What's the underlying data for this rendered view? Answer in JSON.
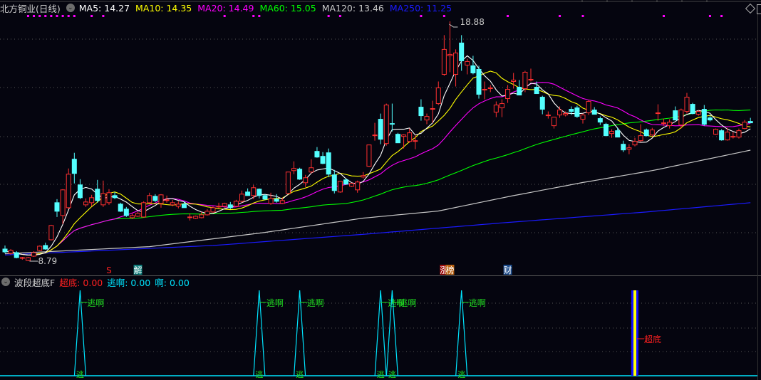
{
  "header": {
    "stock_name": "北方铜业(日线)",
    "toggle_icon": "chevron-down-circle-icon",
    "ma_labels": [
      {
        "text": "MA5: 14.27",
        "color": "#ffffff"
      },
      {
        "text": "MA10: 14.35",
        "color": "#ffff00"
      },
      {
        "text": "MA20: 14.49",
        "color": "#ff00ff"
      },
      {
        "text": "MA60: 15.05",
        "color": "#00ff00"
      },
      {
        "text": "MA120: 13.46",
        "color": "#c8c8c8"
      },
      {
        "text": "MA250: 11.25",
        "color": "#1a1aff"
      }
    ]
  },
  "indicator_header": {
    "name": "波段超底F",
    "labels": [
      {
        "text": "超底: 0.00",
        "color": "#ff2020"
      },
      {
        "text": "逃啊: 0.00",
        "color": "#00e5ff"
      },
      {
        "text": "啊: 0.00",
        "color": "#00e5ff"
      }
    ]
  },
  "chart_data": {
    "type": "candlestick",
    "up_color": "#ff3030",
    "down_color": "#54ffff",
    "ylim": [
      8.79,
      18.88
    ],
    "high_label": "18.88",
    "low_label": "8.79",
    "grid": "dotted",
    "candles_ohlc": [
      [
        9.3,
        9.45,
        9.12,
        9.18
      ],
      [
        9.12,
        9.3,
        9.06,
        9.24
      ],
      [
        9.15,
        9.21,
        8.91,
        8.94
      ],
      [
        8.91,
        8.97,
        8.85,
        8.94
      ],
      [
        8.82,
        8.97,
        8.79,
        8.94
      ],
      [
        9.0,
        9.21,
        8.97,
        9.15
      ],
      [
        9.24,
        9.45,
        9.21,
        9.42
      ],
      [
        9.45,
        9.57,
        9.27,
        9.3
      ],
      [
        9.69,
        10.32,
        9.66,
        10.29
      ],
      [
        11.25,
        11.4,
        10.65,
        10.89
      ],
      [
        10.71,
        11.82,
        10.35,
        11.79
      ],
      [
        11.04,
        12.69,
        10.98,
        12.45
      ],
      [
        13.08,
        13.35,
        12.06,
        12.48
      ],
      [
        12.0,
        12.24,
        11.4,
        11.46
      ],
      [
        11.16,
        11.43,
        11.07,
        11.28
      ],
      [
        11.25,
        11.58,
        11.1,
        11.46
      ],
      [
        11.82,
        12.21,
        11.25,
        11.34
      ],
      [
        11.16,
        12.18,
        11.07,
        11.64
      ],
      [
        11.25,
        11.82,
        11.16,
        11.67
      ],
      [
        11.55,
        11.7,
        11.4,
        11.46
      ],
      [
        11.19,
        11.25,
        10.86,
        10.89
      ],
      [
        10.98,
        11.07,
        10.65,
        10.71
      ],
      [
        10.62,
        10.8,
        10.56,
        10.71
      ],
      [
        10.68,
        10.86,
        10.65,
        10.8
      ],
      [
        10.65,
        11.31,
        10.62,
        11.25
      ],
      [
        11.25,
        11.67,
        11.22,
        11.55
      ],
      [
        11.52,
        11.61,
        11.28,
        11.34
      ],
      [
        11.22,
        11.61,
        11.04,
        11.58
      ],
      [
        11.37,
        11.55,
        11.25,
        11.37
      ],
      [
        11.16,
        11.37,
        11.1,
        11.25
      ],
      [
        11.1,
        11.31,
        11.01,
        11.19
      ],
      [
        11.19,
        11.31,
        11.04,
        11.04
      ],
      [
        10.65,
        10.8,
        10.5,
        10.65
      ],
      [
        10.59,
        10.71,
        10.56,
        10.68
      ],
      [
        10.62,
        10.86,
        10.59,
        10.74
      ],
      [
        10.74,
        10.98,
        10.71,
        10.89
      ],
      [
        10.86,
        11.1,
        10.83,
        11.04
      ],
      [
        11.1,
        11.25,
        11.01,
        11.1
      ],
      [
        11.1,
        11.25,
        11.04,
        11.22
      ],
      [
        11.16,
        11.28,
        10.98,
        11.04
      ],
      [
        11.1,
        11.37,
        11.07,
        11.31
      ],
      [
        11.31,
        11.76,
        11.25,
        11.61
      ],
      [
        11.7,
        11.85,
        11.55,
        11.55
      ],
      [
        11.55,
        12.0,
        11.4,
        11.88
      ],
      [
        11.82,
        11.85,
        11.43,
        11.55
      ],
      [
        11.55,
        11.61,
        11.37,
        11.4
      ],
      [
        11.22,
        11.67,
        11.16,
        11.43
      ],
      [
        11.4,
        11.61,
        11.25,
        11.31
      ],
      [
        11.22,
        11.46,
        11.19,
        11.34
      ],
      [
        11.64,
        12.54,
        11.61,
        12.54
      ],
      [
        12.6,
        12.99,
        12.45,
        12.69
      ],
      [
        12.66,
        12.72,
        12.21,
        12.24
      ],
      [
        12.09,
        12.42,
        11.91,
        12.3
      ],
      [
        12.54,
        13.08,
        12.48,
        12.72
      ],
      [
        13.41,
        13.59,
        13.14,
        13.17
      ],
      [
        13.2,
        13.38,
        12.87,
        12.9
      ],
      [
        13.35,
        13.53,
        12.33,
        12.45
      ],
      [
        12.42,
        12.63,
        11.64,
        11.76
      ],
      [
        11.7,
        12.15,
        11.67,
        12.15
      ],
      [
        12.21,
        12.27,
        12.0,
        12.03
      ],
      [
        11.94,
        12.09,
        11.91,
        12.06
      ],
      [
        11.79,
        12.18,
        11.67,
        12.12
      ],
      [
        12.33,
        12.54,
        12.27,
        12.39
      ],
      [
        12.78,
        13.68,
        12.75,
        13.68
      ],
      [
        14.07,
        14.61,
        13.86,
        14.1
      ],
      [
        14.76,
        15.0,
        13.71,
        13.92
      ],
      [
        13.74,
        15.42,
        13.65,
        15.36
      ],
      [
        14.58,
        15.42,
        14.25,
        14.55
      ],
      [
        14.13,
        14.19,
        13.77,
        13.77
      ],
      [
        14.04,
        14.13,
        13.53,
        14.1
      ],
      [
        13.83,
        14.37,
        13.77,
        14.19
      ],
      [
        13.86,
        14.1,
        13.5,
        13.86
      ],
      [
        15.27,
        15.6,
        14.7,
        14.91
      ],
      [
        14.73,
        15.0,
        14.55,
        14.88
      ],
      [
        15.21,
        15.54,
        14.61,
        15.21
      ],
      [
        15.42,
        16.35,
        15.36,
        16.08
      ],
      [
        16.65,
        18.3,
        16.59,
        17.7
      ],
      [
        17.43,
        18.88,
        16.74,
        17.49
      ],
      [
        16.65,
        17.7,
        16.14,
        17.55
      ],
      [
        17.97,
        18.3,
        16.8,
        17.22
      ],
      [
        17.04,
        17.31,
        16.65,
        17.19
      ],
      [
        17.01,
        17.43,
        16.65,
        16.71
      ],
      [
        16.86,
        17.01,
        15.63,
        15.81
      ],
      [
        15.99,
        16.35,
        15.6,
        16.02
      ],
      [
        16.08,
        16.2,
        15.9,
        16.08
      ],
      [
        15.06,
        15.51,
        14.85,
        15.36
      ],
      [
        15.24,
        15.6,
        14.85,
        15.42
      ],
      [
        15.63,
        16.2,
        15.45,
        16.02
      ],
      [
        16.35,
        16.71,
        16.05,
        16.41
      ],
      [
        16.11,
        16.41,
        15.78,
        15.78
      ],
      [
        16.05,
        16.8,
        15.9,
        16.74
      ],
      [
        16.41,
        16.89,
        16.35,
        16.44
      ],
      [
        16.11,
        16.35,
        15.84,
        15.84
      ],
      [
        15.69,
        15.75,
        14.97,
        15.18
      ],
      [
        14.94,
        15.09,
        14.79,
        14.94
      ],
      [
        14.49,
        14.85,
        14.37,
        14.85
      ],
      [
        14.94,
        15.3,
        14.82,
        15.15
      ],
      [
        14.94,
        15.09,
        14.88,
        15.0
      ],
      [
        15.18,
        15.3,
        14.94,
        15.09
      ],
      [
        15.24,
        15.33,
        14.82,
        14.88
      ],
      [
        14.76,
        15.0,
        14.58,
        14.94
      ],
      [
        15.03,
        15.57,
        14.94,
        15.51
      ],
      [
        15.15,
        15.27,
        14.97,
        14.97
      ],
      [
        14.79,
        14.88,
        14.52,
        14.64
      ],
      [
        14.55,
        14.61,
        14.07,
        14.07
      ],
      [
        14.16,
        14.34,
        13.98,
        14.25
      ],
      [
        14.28,
        14.4,
        14.01,
        14.01
      ],
      [
        13.71,
        13.86,
        13.38,
        13.47
      ],
      [
        13.5,
        13.71,
        13.29,
        13.56
      ],
      [
        13.68,
        13.98,
        13.62,
        13.83
      ],
      [
        13.86,
        14.55,
        13.8,
        14.07
      ],
      [
        14.31,
        14.37,
        14.04,
        14.07
      ],
      [
        14.1,
        14.4,
        14.04,
        14.31
      ],
      [
        15.03,
        15.39,
        14.7,
        15.03
      ],
      [
        14.61,
        14.79,
        14.49,
        14.61
      ],
      [
        14.49,
        14.76,
        14.37,
        14.64
      ],
      [
        15.12,
        15.3,
        14.73,
        14.73
      ],
      [
        14.52,
        15.21,
        14.37,
        15.15
      ],
      [
        15.09,
        15.87,
        15.0,
        15.69
      ],
      [
        15.39,
        15.45,
        14.97,
        15.0
      ],
      [
        14.97,
        15.15,
        14.91,
        15.09
      ],
      [
        15.18,
        15.36,
        14.49,
        14.55
      ],
      [
        14.82,
        14.94,
        14.67,
        14.73
      ],
      [
        14.13,
        14.37,
        14.1,
        14.34
      ],
      [
        14.28,
        14.34,
        13.86,
        13.89
      ],
      [
        13.89,
        14.4,
        13.86,
        14.22
      ],
      [
        14.04,
        14.22,
        13.95,
        14.04
      ],
      [
        14.01,
        14.37,
        13.95,
        14.28
      ],
      [
        14.37,
        14.73,
        14.34,
        14.64
      ],
      [
        14.67,
        14.82,
        14.61,
        14.61
      ]
    ],
    "ma_lines": [
      {
        "name": "MA5",
        "period": 5,
        "color": "#ffffff"
      },
      {
        "name": "MA10",
        "period": 10,
        "color": "#ffff00"
      },
      {
        "name": "MA20",
        "period": 20,
        "color": "#ff00ff"
      },
      {
        "name": "MA60",
        "period": 60,
        "color": "#00ff00"
      }
    ],
    "ma_anchor_lines": [
      {
        "name": "MA120",
        "color": "#c8c8c8",
        "points": [
          [
            0,
            9.1
          ],
          [
            25,
            9.4
          ],
          [
            45,
            10.0
          ],
          [
            62,
            10.6
          ],
          [
            75,
            10.9
          ],
          [
            87,
            11.5
          ],
          [
            100,
            12.1
          ],
          [
            112,
            12.6
          ],
          [
            129,
            13.46
          ]
        ]
      },
      {
        "name": "MA250",
        "color": "#1a1aff",
        "points": [
          [
            0,
            9.05
          ],
          [
            36,
            9.45
          ],
          [
            61,
            9.9
          ],
          [
            86,
            10.4
          ],
          [
            111,
            10.86
          ],
          [
            129,
            11.25
          ]
        ]
      }
    ],
    "signal_dot_indices": [
      4,
      5,
      6,
      7,
      8,
      9,
      10,
      11,
      12,
      15,
      17,
      38,
      43,
      44,
      56,
      58,
      72,
      76,
      87,
      96,
      100,
      114,
      122,
      124
    ],
    "signal_dot_color": "#ff00ff",
    "events": [
      {
        "index": 18,
        "text": "S",
        "color": "#ff2020",
        "bg": ""
      },
      {
        "index": 23,
        "text": "解",
        "color": "#ffffff",
        "bg": "#0a7a78"
      },
      {
        "index": 76,
        "text": "涨",
        "color": "#ffffff",
        "bg": "#a01010"
      },
      {
        "index": 77,
        "text": "榜",
        "color": "#ffffff",
        "bg": "#b86010"
      },
      {
        "index": 87,
        "text": "财",
        "color": "#ffffff",
        "bg": "#1a4a8a"
      }
    ],
    "indicator": {
      "escape_signals": [
        {
          "index": 13,
          "top_label": "逃啊",
          "bottom_label": "逃"
        },
        {
          "index": 44,
          "top_label": "逃啊",
          "bottom_label": "逃"
        },
        {
          "index": 51,
          "top_label": "逃啊",
          "bottom_label": "逃"
        },
        {
          "index": 65,
          "top_label": "逃啊",
          "bottom_label": "逃"
        },
        {
          "index": 67,
          "top_label": "逃啊",
          "bottom_label": "逃"
        },
        {
          "index": 79,
          "top_label": "逃啊",
          "bottom_label": "逃"
        }
      ],
      "bottom_signals": [
        {
          "index": 109,
          "label": "超底"
        }
      ],
      "escape_color": "#00e5ff",
      "escape_label_color": "#20e020",
      "bottom_label_color": "#ff2020"
    }
  }
}
